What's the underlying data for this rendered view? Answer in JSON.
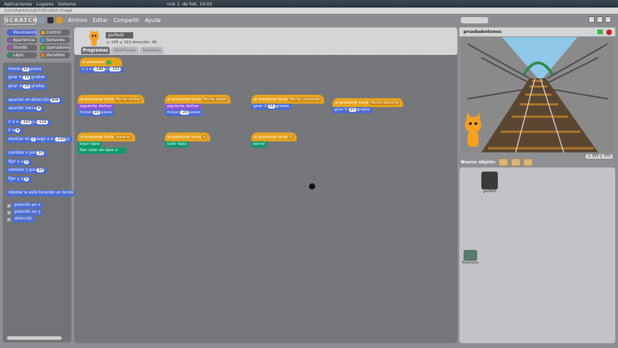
{
  "system": {
    "menus": [
      "Aplicaciones",
      "Lugares",
      "Sistema"
    ],
    "clock": "mié 1, de feb, 14:03"
  },
  "path": "/usr/share/scratch/Scratch.image",
  "app": {
    "logo": "SCRATCH",
    "menu": [
      "Archivo",
      "Editar",
      "Compartir",
      "Ayuda"
    ]
  },
  "categories": [
    {
      "label": "Movimiento",
      "color": "#4a6cd4"
    },
    {
      "label": "Control",
      "color": "#e1a91a"
    },
    {
      "label": "Apariencia",
      "color": "#8a55d7"
    },
    {
      "label": "Sensores",
      "color": "#2ca5e2"
    },
    {
      "label": "Sonido",
      "color": "#bb42c3"
    },
    {
      "label": "Operadores",
      "color": "#5cb712"
    },
    {
      "label": "Lápiz",
      "color": "#0e9a6c"
    },
    {
      "label": "Variables",
      "color": "#ee7d16"
    }
  ],
  "palette": [
    {
      "pre": "mover",
      "v1": "10",
      "post": "pasos"
    },
    {
      "pre": "girar ↻",
      "v1": "15",
      "post": "grados"
    },
    {
      "pre": "girar ↺",
      "v1": "15",
      "post": "grados"
    },
    {
      "pre": "apuntar en dirección",
      "v1": "90▾",
      "post": ""
    },
    {
      "pre": "apuntar hacia",
      "v1": "▾",
      "post": ""
    },
    {
      "pre": "ir a x:",
      "v1": "-193",
      "post": "y:",
      "v2": "-119"
    },
    {
      "pre": "ir a",
      "v1": "▾",
      "post": ""
    },
    {
      "pre": "deslizar en",
      "v1": "1",
      "post": "segs a x:",
      "v2": "-193",
      "post2": "y:"
    },
    {
      "pre": "cambiar x por",
      "v1": "10",
      "post": ""
    },
    {
      "pre": "fijar x a",
      "v1": "0",
      "post": ""
    },
    {
      "pre": "cambiar y por",
      "v1": "10",
      "post": ""
    },
    {
      "pre": "fijar y a",
      "v1": "0",
      "post": ""
    },
    {
      "pre": "rebotar si está tocando un borde",
      "v1": "",
      "post": ""
    }
  ],
  "checks": [
    "posición en x",
    "posición en y",
    "dirección"
  ],
  "sprite": {
    "name": "garfield",
    "coords": "x: 105  y: 110  dirección: 90"
  },
  "tabs": [
    "Programas",
    "Disfraces",
    "Sonidos"
  ],
  "scripts": {
    "hat_flag": "al presionar",
    "goto": {
      "pre": "ir a x:",
      "x": "-188",
      "mid": "y:",
      "y": "-152"
    },
    "h1": {
      "label": "al presionar tecla",
      "key": "flecha arriba"
    },
    "h2": {
      "label": "al presionar tecla",
      "key": "flecha abajo"
    },
    "h3": {
      "label": "al presionar tecla",
      "key": "flecha izquierda"
    },
    "h4": {
      "label": "al presionar tecla",
      "key": "flecha derecha"
    },
    "next1": "siguiente disfraz",
    "move1": {
      "pre": "mover",
      "v": "20",
      "post": "pasos"
    },
    "next2": "siguiente disfraz",
    "move2": {
      "pre": "mover",
      "v": "-20",
      "post": "pasos"
    },
    "turn1": {
      "pre": "girar ↺",
      "v": "15",
      "post": "grados"
    },
    "turn2": {
      "pre": "girar ↻",
      "v": "15",
      "post": "grados"
    },
    "h5": {
      "label": "al presionar tecla",
      "key": "espacio"
    },
    "h6": {
      "label": "al presionar tecla",
      "key": "a"
    },
    "h7": {
      "label": "al presionar tecla",
      "key": "b"
    },
    "pendown": "bajar lápiz",
    "pencolor": "fijar color de lápiz a",
    "penup": "subir lápiz",
    "clear": "borrar"
  },
  "stage": {
    "title": "pruebabotones",
    "xy": "x: 555  y: 370"
  },
  "newobj": "Nuevo objeto:",
  "sprites": [
    {
      "label": "garfield"
    },
    {
      "label": "Escenario"
    }
  ]
}
